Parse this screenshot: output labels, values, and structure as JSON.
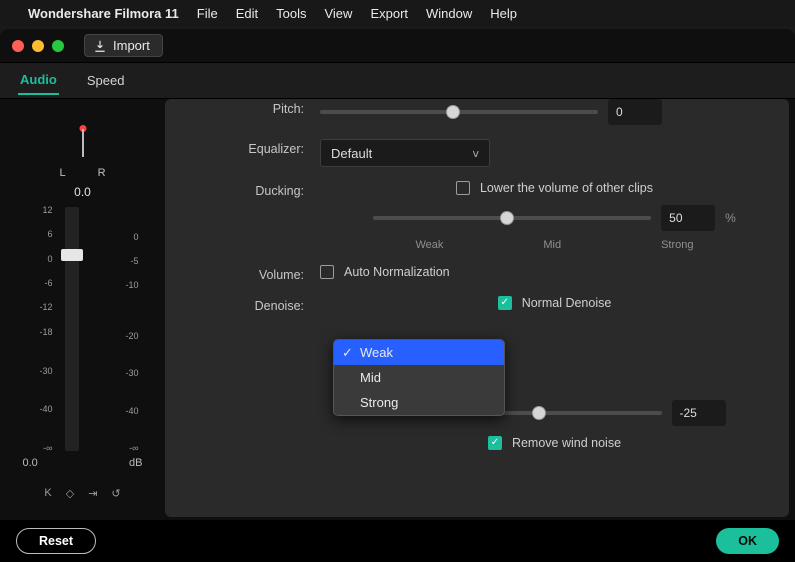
{
  "menu_bar": {
    "app_name": "Wondershare Filmora 11",
    "items": [
      "File",
      "Edit",
      "Tools",
      "View",
      "Export",
      "Window",
      "Help"
    ]
  },
  "title_bar": {
    "import_label": "Import"
  },
  "tabs": {
    "audio": "Audio",
    "speed": "Speed"
  },
  "meter": {
    "L": "L",
    "R": "R",
    "top_value": "0.0",
    "scale_left": [
      "12",
      "6",
      "0",
      "-6",
      "-12",
      "-18",
      "",
      "-30",
      "",
      "-40",
      "",
      "-∞"
    ],
    "scale_right": [
      "",
      "",
      "0",
      "-5",
      "-10",
      "",
      "",
      "-20",
      "",
      "-30",
      "",
      "-40",
      "",
      "-∞"
    ],
    "bottom_value": "0.0",
    "bottom_unit": "dB"
  },
  "settings": {
    "pitch": {
      "label": "Pitch:",
      "value": "0"
    },
    "equalizer": {
      "label": "Equalizer:",
      "value": "Default"
    },
    "ducking": {
      "label": "Ducking:",
      "checkbox_label": "Lower the volume of other clips",
      "value": "50",
      "pct": "%",
      "scale": {
        "weak": "Weak",
        "mid": "Mid",
        "strong": "Strong"
      }
    },
    "volume": {
      "label": "Volume:",
      "checkbox_label": "Auto Normalization"
    },
    "denoise": {
      "label": "Denoise:",
      "normal_label": "Normal Denoise",
      "options": {
        "weak": "Weak",
        "mid": "Mid",
        "strong": "Strong"
      },
      "slider_value": "-25",
      "remove_wind_label": "Remove wind noise"
    }
  },
  "footer": {
    "reset": "Reset",
    "ok": "OK"
  }
}
